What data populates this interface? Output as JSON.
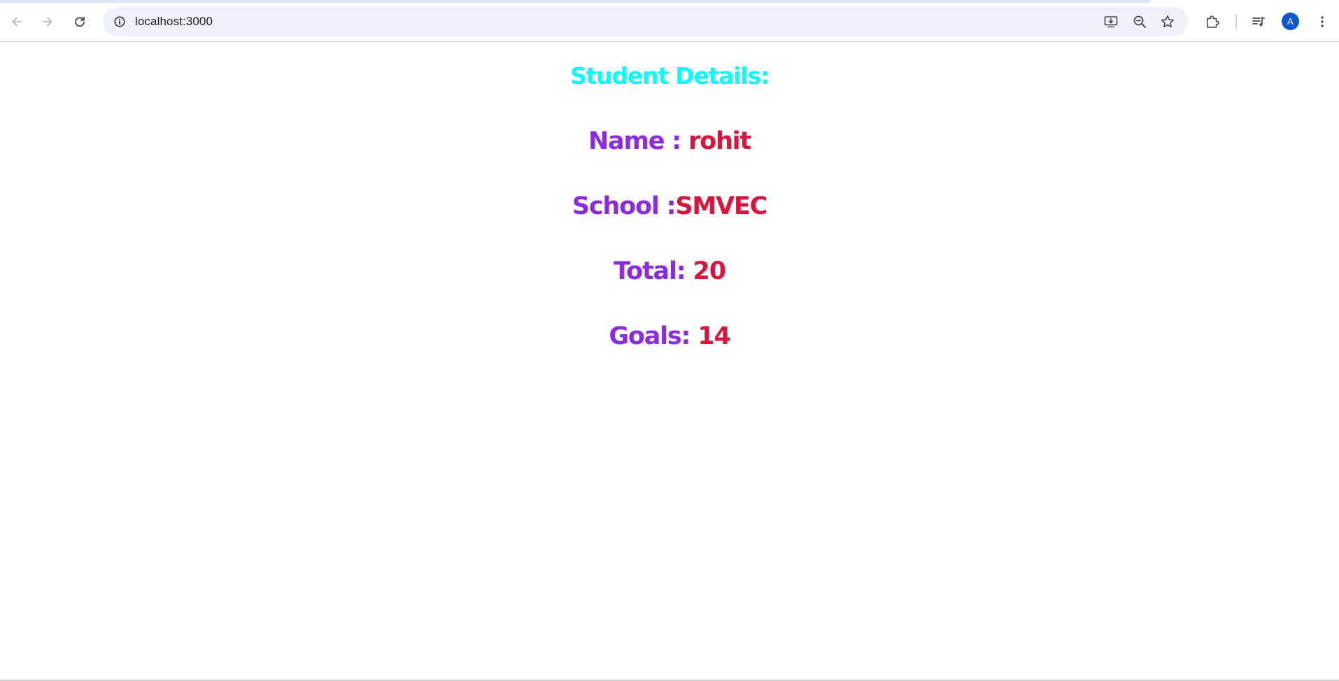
{
  "browser": {
    "url": "localhost:3000",
    "profile_initial": "A",
    "accent_color": "#0b57d0"
  },
  "page": {
    "heading": "Student Details:",
    "heading_color": "#00ffff",
    "label_color": "#8a2be2",
    "value_color": "#dc143c",
    "rows": [
      {
        "label": "Name : ",
        "value": "rohit"
      },
      {
        "label": "School :",
        "value": "SMVEC"
      },
      {
        "label": "Total: ",
        "value": "20"
      },
      {
        "label": "Goals: ",
        "value": "14"
      }
    ]
  }
}
